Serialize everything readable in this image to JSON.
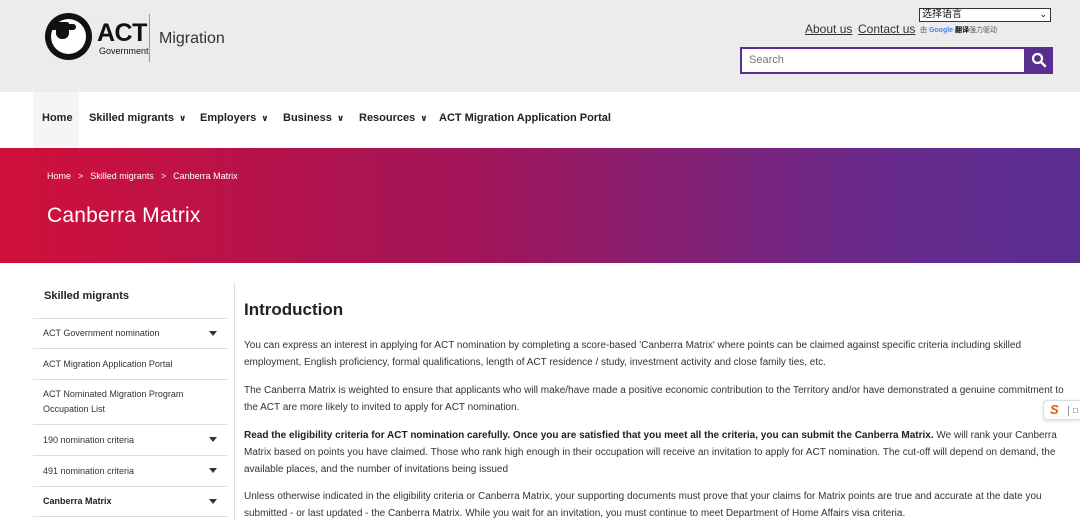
{
  "header": {
    "logo_text": "ACT",
    "logo_subtext": "Government",
    "site_name": "Migration",
    "about_label": "About us",
    "contact_label": "Contact us",
    "language_select": "选择语言",
    "powered_prefix": "由",
    "powered_google": "Google",
    "powered_translate": "翻译",
    "powered_suffix": "强力驱动",
    "search_placeholder": "Search"
  },
  "nav": {
    "items": [
      {
        "label": "Home",
        "dropdown": false
      },
      {
        "label": "Skilled migrants",
        "dropdown": true
      },
      {
        "label": "Employers",
        "dropdown": true
      },
      {
        "label": "Business",
        "dropdown": true
      },
      {
        "label": "Resources",
        "dropdown": true
      },
      {
        "label": "ACT Migration Application Portal",
        "dropdown": false
      }
    ]
  },
  "banner": {
    "breadcrumb": [
      "Home",
      "Skilled migrants",
      "Canberra Matrix"
    ],
    "separator": ">",
    "title": "Canberra Matrix",
    "gradient_start": "#d0103a",
    "gradient_end": "#5a2d91"
  },
  "sidebar": {
    "heading": "Skilled migrants",
    "items": [
      {
        "label": "ACT Government nomination",
        "expandable": true
      },
      {
        "label": "ACT Migration Application Portal",
        "expandable": false
      },
      {
        "label": "ACT Nominated Migration Program Occupation List",
        "expandable": false
      },
      {
        "label": "190 nomination criteria",
        "expandable": true
      },
      {
        "label": "491 nomination criteria",
        "expandable": true
      },
      {
        "label": "Canberra Matrix",
        "expandable": true
      }
    ]
  },
  "main": {
    "title": "Introduction",
    "p1": "You can express an interest in applying for ACT nomination by completing a score-based 'Canberra Matrix' where points can be claimed against specific criteria including skilled employment, English proficiency, formal qualifications, length of ACT residence / study, investment activity and close family ties, etc.",
    "p2": "The Canberra Matrix is weighted to ensure that applicants who will make/have made a positive economic contribution to the Territory and/or have demonstrated a genuine commitment to the ACT are more likely to invited to apply for ACT nomination.",
    "p3_bold": "Read the eligibility criteria for ACT nomination carefully. Once you are satisfied that you meet all the criteria, you can submit the Canberra Matrix.",
    "p3_rest": " We will rank your Canberra Matrix based on points you have claimed. Those who rank high enough in their occupation will receive an invitation to apply for ACT nomination. The cut-off will depend on demand, the available places, and the number of invitations being issued",
    "p4": "Unless otherwise indicated in the eligibility criteria or Canberra Matrix, your supporting documents must prove that your claims for Matrix points are true and accurate at the date you submitted - or last updated - the Canberra Matrix. While you wait for an invitation, you must continue to meet Department of Home Affairs visa criteria."
  },
  "colors": {
    "accent_purple": "#5a2d91",
    "header_bg": "#ececec"
  }
}
